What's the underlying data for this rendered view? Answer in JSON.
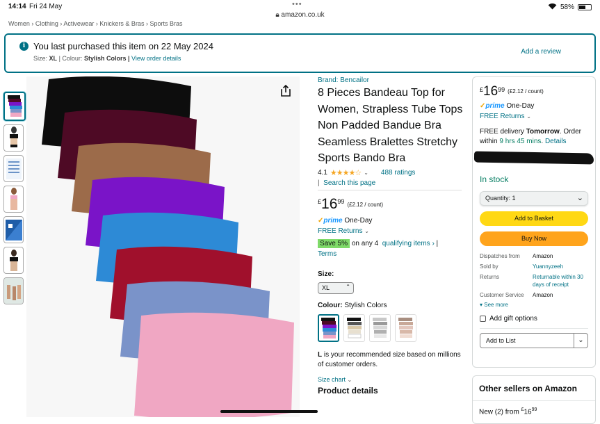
{
  "status": {
    "time": "14:14",
    "date": "Fri 24 May",
    "url": "amazon.co.uk",
    "battery": "58%"
  },
  "breadcrumb": [
    "Women",
    "Clothing",
    "Activewear",
    "Knickers & Bras",
    "Sports Bras"
  ],
  "notice": {
    "title": "You last purchased this item on 22 May 2024",
    "size_label": "Size:",
    "size_value": "XL",
    "colour_label": "| Colour:",
    "colour_value": "Stylish Colors",
    "view_order": "View order details",
    "add_review": "Add a review"
  },
  "product": {
    "brand": "Brand: Bencailor",
    "title": "8 Pieces Bandeau Top for Women, Strapless Tube Tops Non Padded Bandue Bra Seamless Bralettes Stretchy Sports Bando Bra",
    "rating": "4.1",
    "rating_fraction": 0.82,
    "ratings_count": "488 ratings",
    "search_page": "Search this page",
    "price_symbol": "£",
    "price_whole": "16",
    "price_fraction": "99",
    "unit_price": "(£2.12 / count)",
    "prime_label": "prime",
    "prime_delivery": "One-Day",
    "free_returns": "FREE Returns",
    "save_badge": "Save 5%",
    "save_text": "on any 4",
    "qualifying": "qualifying items ›",
    "terms": "Terms",
    "size_label": "Size:",
    "size_value": "XL",
    "colour_label": "Colour:",
    "colour_value": "Stylish Colors",
    "recommendation_bold": "L",
    "recommendation_text": "is your recommended size based on millions of customer orders.",
    "size_chart": "Size chart",
    "product_details": "Product details"
  },
  "swatch_colors": [
    "#0d0d0d",
    "#4e0a25",
    "#9c6b4a",
    "#7a14c8",
    "#2d8ad6",
    "#a0102c",
    "#7a93c9",
    "#f0a7c3"
  ],
  "buybox": {
    "price_symbol": "£",
    "price_whole": "16",
    "price_fraction": "99",
    "unit_price": "(£2.12 / count)",
    "prime_label": "prime",
    "prime_delivery": "One-Day",
    "free_returns": "FREE Returns",
    "delivery_prefix": "FREE delivery",
    "delivery_day": "Tomorrow",
    "delivery_mid": ". Order within",
    "delivery_time": "9 hrs 45 mins",
    "details": "Details",
    "in_stock": "In stock",
    "quantity": "Quantity: 1",
    "add_basket": "Add to Basket",
    "buy_now": "Buy Now",
    "dispatches_label": "Dispatches from",
    "dispatches_value": "Amazon",
    "sold_label": "Sold by",
    "sold_value": "Yuannyzeeh",
    "returns_label": "Returns",
    "returns_value": "Returnable within 30 days of receipt",
    "service_label": "Customer Service",
    "service_value": "Amazon",
    "see_more": "See more",
    "gift": "Add gift options",
    "add_list": "Add to List"
  },
  "sellers": {
    "heading": "Other sellers on Amazon",
    "new_text": "New (2) from",
    "price_symbol": "£",
    "price_whole": "16",
    "price_fraction": "99"
  }
}
